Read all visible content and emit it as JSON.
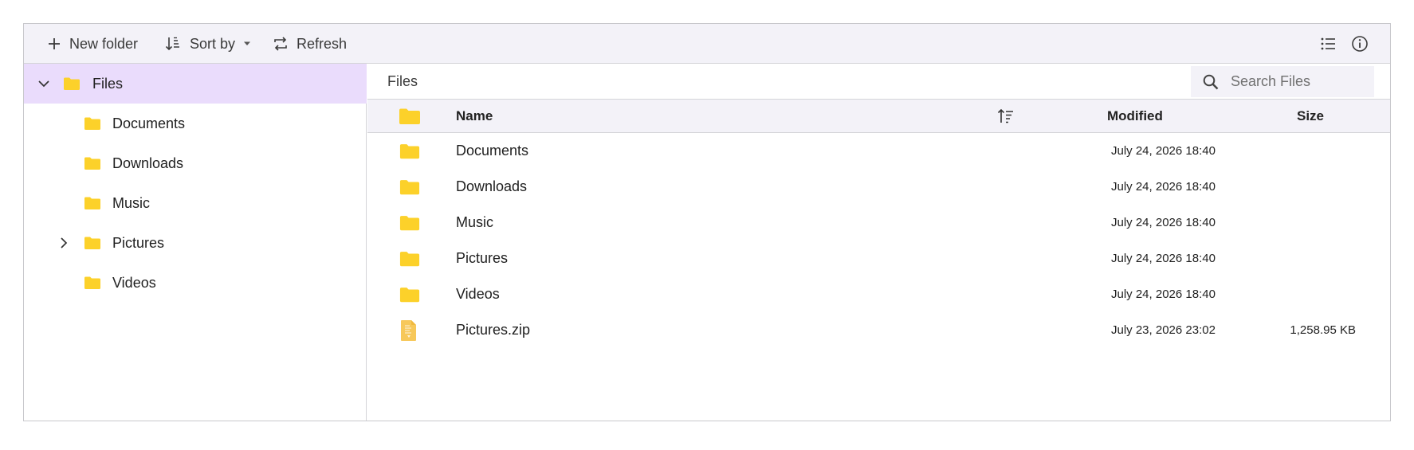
{
  "toolbar": {
    "new_folder_label": "New folder",
    "sort_by_label": "Sort by",
    "refresh_label": "Refresh"
  },
  "navigation": {
    "root": {
      "label": "Files",
      "expanded": true
    },
    "items": [
      {
        "label": "Documents",
        "has_children": false
      },
      {
        "label": "Downloads",
        "has_children": false
      },
      {
        "label": "Music",
        "has_children": false
      },
      {
        "label": "Pictures",
        "has_children": true
      },
      {
        "label": "Videos",
        "has_children": false
      }
    ]
  },
  "address_bar": {
    "breadcrumb": "Files",
    "search_placeholder": "Search Files"
  },
  "grid": {
    "columns": {
      "name": "Name",
      "modified": "Modified",
      "size": "Size"
    },
    "rows": [
      {
        "icon": "folder-icon",
        "name": "Documents",
        "modified": "July 24, 2026 18:40",
        "size": ""
      },
      {
        "icon": "folder-icon",
        "name": "Downloads",
        "modified": "July 24, 2026 18:40",
        "size": ""
      },
      {
        "icon": "folder-icon",
        "name": "Music",
        "modified": "July 24, 2026 18:40",
        "size": ""
      },
      {
        "icon": "folder-icon",
        "name": "Pictures",
        "modified": "July 24, 2026 18:40",
        "size": ""
      },
      {
        "icon": "folder-icon",
        "name": "Videos",
        "modified": "July 24, 2026 18:40",
        "size": ""
      },
      {
        "icon": "zip-file-icon",
        "name": "Pictures.zip",
        "modified": "July 23, 2026 23:02",
        "size": "1,258.95 KB"
      }
    ]
  },
  "colors": {
    "toolbar_bg": "#f3f2f8",
    "selected_bg": "#eadcfc",
    "folder": "#fcd12a",
    "zip": "#f7c85a"
  }
}
